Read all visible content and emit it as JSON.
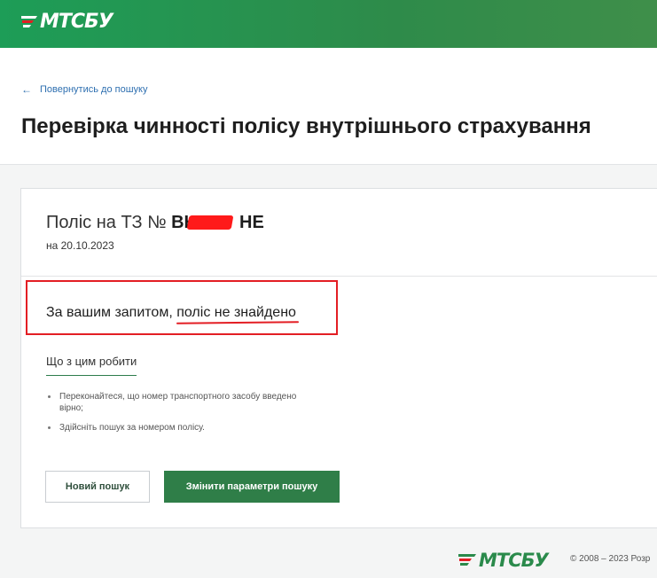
{
  "brand": {
    "logo_text": "МТСБУ",
    "primary_color": "#2e8b4a",
    "alert_color": "#e31e24"
  },
  "header": {
    "back_link": "Повернутись до пошуку",
    "title": "Перевірка чинності полісу внутрішнього страхування"
  },
  "policy": {
    "heading_prefix": "Поліс на ТЗ №",
    "number_visible_start": "ВН",
    "number_visible_end": "НЕ",
    "date": "на 20.10.2023"
  },
  "result": {
    "text_prefix": "За вашим запитом, ",
    "text_strong": "поліс не знайдено"
  },
  "help": {
    "title": "Що з цим робити",
    "tips": [
      "Переконайтеся, що номер транспортного засобу введено вірно;",
      "Здійсніть пошук за номером полісу."
    ]
  },
  "actions": {
    "new_search": "Новий пошук",
    "change_params": "Змінити параметри пошуку"
  },
  "footer": {
    "logo_text": "МТСБУ",
    "copyright": "© 2008 – 2023 Розр"
  }
}
